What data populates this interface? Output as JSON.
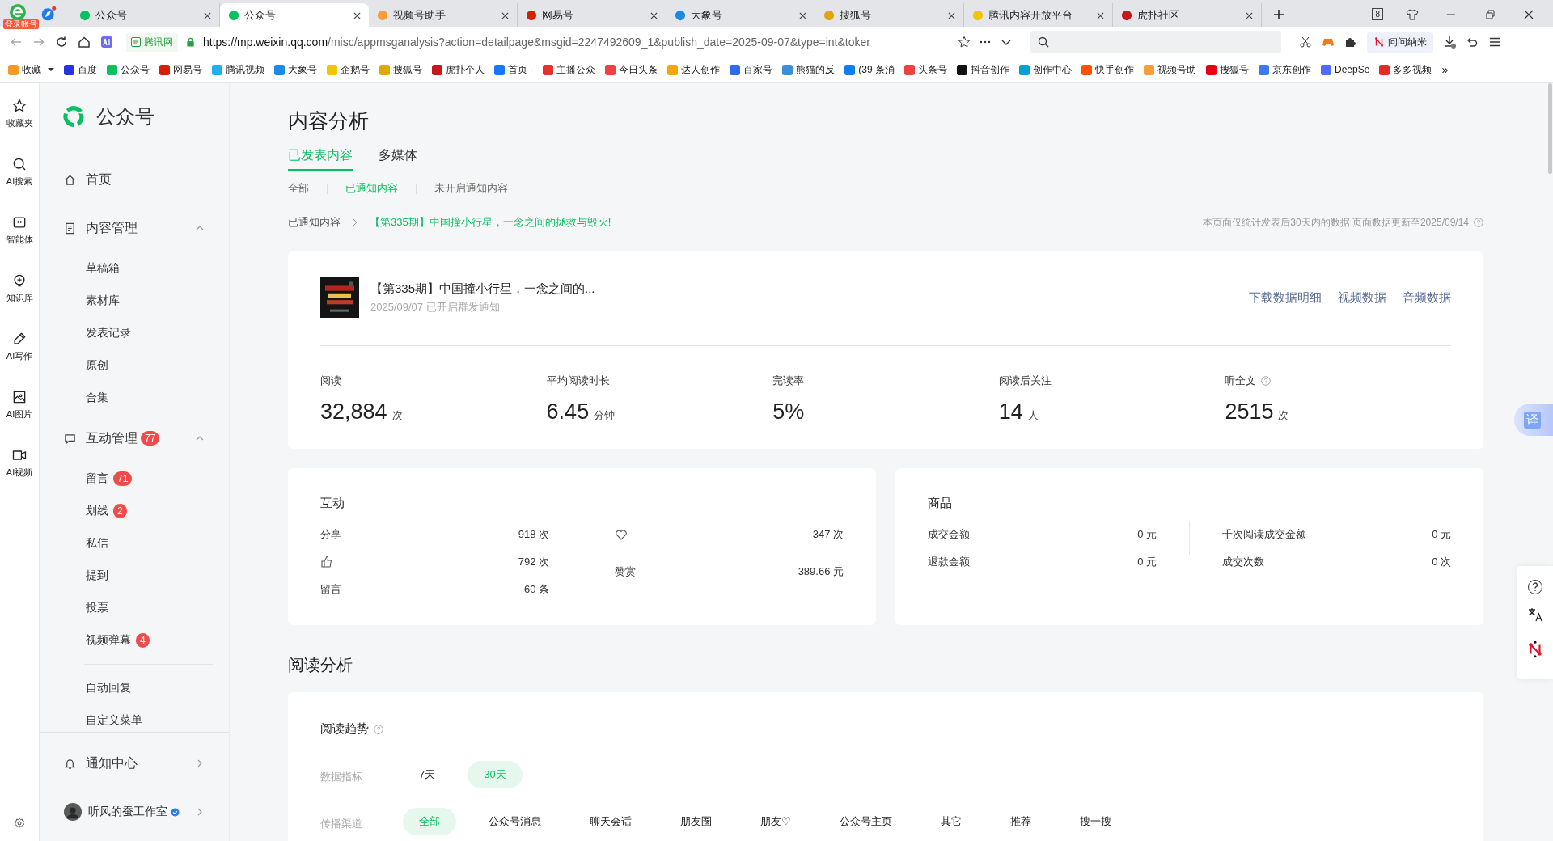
{
  "browser": {
    "login_badge": "登录账号",
    "tabs": [
      {
        "title": "公众号",
        "color": "#07c160",
        "selected": false
      },
      {
        "title": "公众号",
        "color": "#07c160",
        "selected": true
      },
      {
        "title": "视频号助手",
        "color": "#fa9d3b",
        "selected": false
      },
      {
        "title": "网易号",
        "color": "#d81e06",
        "selected": false
      },
      {
        "title": "大象号",
        "color": "#1e88e5",
        "selected": false
      },
      {
        "title": "搜狐号",
        "color": "#e0a800",
        "selected": false
      },
      {
        "title": "腾讯内容开放平台",
        "color": "#f5c400",
        "selected": false
      },
      {
        "title": "虎扑社区",
        "color": "#c8161d",
        "selected": false
      }
    ],
    "tab_count": "8",
    "site_badge": "腾讯网",
    "url_host": "https://mp.weixin.qq.com",
    "url_rest": "/misc/appmsganalysis?action=detailpage&msgid=2247492609_1&publish_date=2025-09-07&type=int&toker",
    "extension_label": "问问纳米",
    "bookmarks": [
      {
        "title": "收藏",
        "color": "#f59a23"
      },
      {
        "title": "百度",
        "color": "#2932e1"
      },
      {
        "title": "公众号",
        "color": "#07c160"
      },
      {
        "title": "网易号",
        "color": "#d81e06"
      },
      {
        "title": "腾讯视频",
        "color": "#20b0f0"
      },
      {
        "title": "大象号",
        "color": "#1e88e5"
      },
      {
        "title": "企鹅号",
        "color": "#f5c400"
      },
      {
        "title": "搜狐号",
        "color": "#e0a800"
      },
      {
        "title": "虎扑个人",
        "color": "#c8161d"
      },
      {
        "title": "首页 -",
        "color": "#1677ff"
      },
      {
        "title": "主播公众",
        "color": "#e5322d"
      },
      {
        "title": "今日头条",
        "color": "#f04142"
      },
      {
        "title": "达人创作",
        "color": "#f7a600"
      },
      {
        "title": "百家号",
        "color": "#2f6be8"
      },
      {
        "title": "熊猫的反",
        "color": "#3a8fd8"
      },
      {
        "title": "(39 条消",
        "color": "#0e7ef0"
      },
      {
        "title": "头条号",
        "color": "#f04142"
      },
      {
        "title": "抖音创作",
        "color": "#111111"
      },
      {
        "title": "创作中心",
        "color": "#00a1d6"
      },
      {
        "title": "快手创作",
        "color": "#ff5000"
      },
      {
        "title": "视频号助",
        "color": "#fa9d3b"
      },
      {
        "title": "搜狐号",
        "color": "#e60012"
      },
      {
        "title": "京东创作",
        "color": "#3a7bf0"
      },
      {
        "title": "DeepSe",
        "color": "#4d6bfe"
      },
      {
        "title": "多多视频",
        "color": "#e02e24"
      }
    ],
    "more": "»"
  },
  "rail": {
    "items": [
      {
        "label": "收藏夹"
      },
      {
        "label": "AI搜索"
      },
      {
        "label": "智能体"
      },
      {
        "label": "知识库"
      },
      {
        "label": "AI写作"
      },
      {
        "label": "AI图片"
      },
      {
        "label": "AI视频"
      }
    ]
  },
  "sidebar": {
    "brand": "公众号",
    "items": [
      {
        "label": "首页"
      },
      {
        "label": "内容管理",
        "expanded": true,
        "children": [
          {
            "label": "草稿箱"
          },
          {
            "label": "素材库"
          },
          {
            "label": "发表记录"
          },
          {
            "label": "原创"
          },
          {
            "label": "合集"
          }
        ]
      },
      {
        "label": "互动管理",
        "badge": "77",
        "expanded": true,
        "children": [
          {
            "label": "留言",
            "badge": "71"
          },
          {
            "label": "划线",
            "badge": "2"
          },
          {
            "label": "私信"
          },
          {
            "label": "提到"
          },
          {
            "label": "投票"
          },
          {
            "label": "视频弹幕",
            "badge": "4"
          }
        ]
      }
    ],
    "extra_items": [
      {
        "label": "自动回复"
      },
      {
        "label": "自定义菜单"
      }
    ],
    "notify": "通知中心",
    "user": "听风的蚕工作室"
  },
  "main": {
    "title": "内容分析",
    "tabs": [
      {
        "label": "已发表内容",
        "selected": true
      },
      {
        "label": "多媒体",
        "selected": false
      }
    ],
    "subtabs": [
      {
        "label": "全部",
        "selected": false
      },
      {
        "label": "已通知内容",
        "selected": true
      },
      {
        "label": "未开启通知内容",
        "selected": false
      }
    ],
    "breadcrumb": [
      "已通知内容",
      "【第335期】中国撞小行星，一念之间的拯救与毁灭!"
    ],
    "note": "本页面仅统计发表后30天内的数据 页面数据更新至2025/09/14",
    "article": {
      "title": "【第335期】中国撞小行星，一念之间的...",
      "meta": "2025/09/07 已开启群发通知",
      "actions": [
        "下载数据明细",
        "视频数据",
        "音频数据"
      ]
    },
    "stats": [
      {
        "label": "阅读",
        "value": "32,884",
        "unit": "次"
      },
      {
        "label": "平均阅读时长",
        "value": "6.45",
        "unit": "分钟"
      },
      {
        "label": "完读率",
        "value": "5%"
      },
      {
        "label": "阅读后关注",
        "value": "14",
        "unit": "人"
      },
      {
        "label": "听全文",
        "value": "2515",
        "unit": "次",
        "help": true
      }
    ],
    "interaction": {
      "title": "互动",
      "left": [
        {
          "kind": "text",
          "label": "分享",
          "value": "918 次"
        },
        {
          "kind": "thumb",
          "value": "792 次"
        },
        {
          "kind": "text",
          "label": "留言",
          "value": "60 条"
        }
      ],
      "right": [
        {
          "kind": "heart",
          "value": "347 次"
        },
        {
          "kind": "text",
          "label": "赞赏",
          "value": "389.66 元"
        }
      ]
    },
    "goods": {
      "title": "商品",
      "left": [
        {
          "label": "成交金额",
          "value": "0 元"
        },
        {
          "label": "退款金额",
          "value": "0 元"
        }
      ],
      "right": [
        {
          "label": "千次阅读成交金额",
          "value": "0 元"
        },
        {
          "label": "成交次数",
          "value": "0 次"
        }
      ]
    },
    "section_title": "阅读分析",
    "trend": {
      "title": "阅读趋势",
      "metric_label": "数据指标",
      "ranges": [
        {
          "label": "7天",
          "selected": false
        },
        {
          "label": "30天",
          "selected": true
        }
      ],
      "channel_label": "传播渠道",
      "channels": [
        {
          "label": "全部",
          "selected": true
        },
        {
          "label": "公众号消息",
          "selected": false
        },
        {
          "label": "聊天会话",
          "selected": false
        },
        {
          "label": "朋友圈",
          "selected": false
        },
        {
          "label": "朋友♡",
          "selected": false
        },
        {
          "label": "公众号主页",
          "selected": false
        },
        {
          "label": "其它",
          "selected": false
        },
        {
          "label": "推荐",
          "selected": false
        },
        {
          "label": "搜一搜",
          "selected": false
        }
      ]
    }
  },
  "float": {
    "translate": "译"
  }
}
